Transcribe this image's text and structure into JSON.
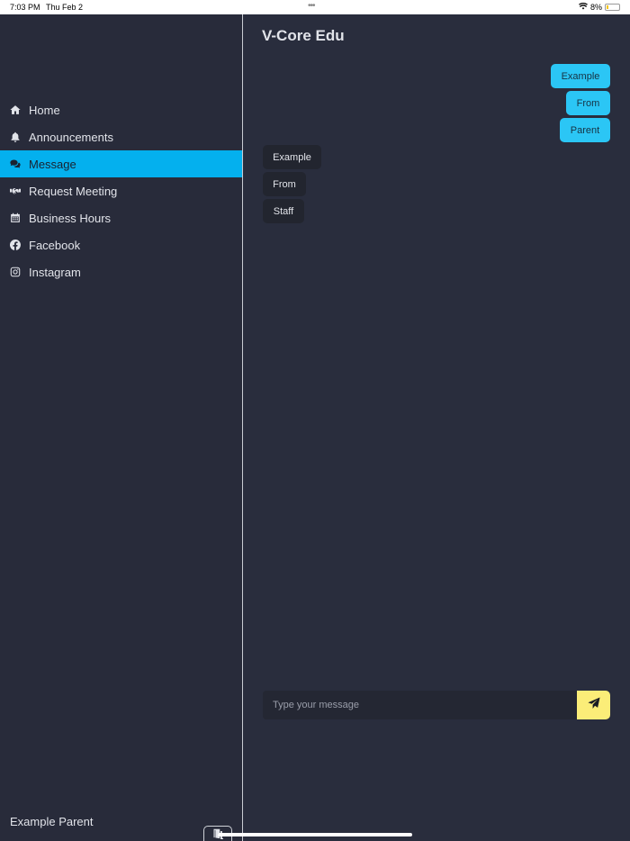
{
  "status_bar": {
    "time": "7:03 PM",
    "date": "Thu Feb 2",
    "dots": "•••",
    "battery": "8%"
  },
  "app": {
    "title": "V-Core Edu"
  },
  "sidebar": {
    "items": [
      {
        "label": "Home",
        "icon": "home-icon",
        "active": false
      },
      {
        "label": "Announcements",
        "icon": "bell-icon",
        "active": false
      },
      {
        "label": "Message",
        "icon": "comments-icon",
        "active": true
      },
      {
        "label": "Request Meeting",
        "icon": "handshake-icon",
        "active": false
      },
      {
        "label": "Business Hours",
        "icon": "calendar-icon",
        "active": false
      },
      {
        "label": "Facebook",
        "icon": "facebook-icon",
        "active": false
      },
      {
        "label": "Instagram",
        "icon": "instagram-icon",
        "active": false
      }
    ],
    "user_name": "Example Parent",
    "logout_icon": "door-exit-icon"
  },
  "messages": {
    "sent": [
      "Example",
      "From",
      "Parent"
    ],
    "received": [
      "Example",
      "From",
      "Staff"
    ]
  },
  "composer": {
    "placeholder": "Type your message",
    "value": "",
    "send_icon": "paper-plane-icon"
  },
  "colors": {
    "background": "#292d3d",
    "sidebar": "#282b3a",
    "active_item": "#04b0ee",
    "sent_bubble": "#2bc6f5",
    "received_bubble": "#22252f",
    "send_button": "#fbed78"
  }
}
